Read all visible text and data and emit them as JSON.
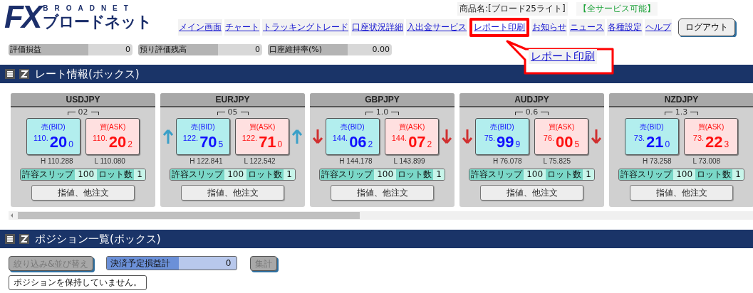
{
  "header": {
    "logo": {
      "mark": "FX",
      "latin": "BROADNET",
      "kana": "ブロードネット"
    },
    "product": "商品名:[ブロード25ライト]",
    "service_status": "【全サービス可能】",
    "nav": [
      {
        "label": "メイン画面",
        "highlighted": false
      },
      {
        "label": "チャート",
        "highlighted": false
      },
      {
        "label": "トラッキングトレード",
        "highlighted": false
      },
      {
        "label": "口座状況詳細",
        "highlighted": false
      },
      {
        "label": "入出金サービス",
        "highlighted": false
      },
      {
        "label": "レポート印刷",
        "highlighted": true
      },
      {
        "label": "お知らせ",
        "highlighted": false
      },
      {
        "label": "ニュース",
        "highlighted": false
      },
      {
        "label": "各種設定",
        "highlighted": false
      },
      {
        "label": "ヘルプ",
        "highlighted": false
      }
    ],
    "logout": "ログアウト"
  },
  "callout": {
    "label": "レポート印刷"
  },
  "summary": [
    {
      "label": "評価損益",
      "value": "0"
    },
    {
      "label": "預り評価残高",
      "value": "0"
    },
    {
      "label": "口座維持率(%)",
      "value": "0.00"
    }
  ],
  "rate_panel": {
    "title": "レート情報(ボックス)",
    "cards": [
      {
        "pair": "USDJPY",
        "spread": "02",
        "kind": "flat",
        "bid": {
          "label": "売(BID)",
          "big_figure": "110.",
          "pips": "20",
          "fraction": "0"
        },
        "ask": {
          "label": "買(ASK)",
          "big_figure": "110.",
          "pips": "20",
          "fraction": "2"
        },
        "high": "H 110.288",
        "low": "L 110.080",
        "slip_label": "許容スリップ",
        "slip": "100",
        "lot_label": "ロット数",
        "lot": "1",
        "order_button": "指値、他注文"
      },
      {
        "pair": "EURJPY",
        "spread": "05",
        "kind": "up",
        "bid": {
          "label": "売(BID)",
          "big_figure": "122.",
          "pips": "70",
          "fraction": "5"
        },
        "ask": {
          "label": "買(ASK)",
          "big_figure": "122.",
          "pips": "71",
          "fraction": "0"
        },
        "high": "H 122.841",
        "low": "L 122.542",
        "slip_label": "許容スリップ",
        "slip": "100",
        "lot_label": "ロット数",
        "lot": "1",
        "order_button": "指値、他注文"
      },
      {
        "pair": "GBPJPY",
        "spread": "1.0",
        "kind": "down",
        "bid": {
          "label": "売(BID)",
          "big_figure": "144.",
          "pips": "06",
          "fraction": "2"
        },
        "ask": {
          "label": "買(ASK)",
          "big_figure": "144.",
          "pips": "07",
          "fraction": "2"
        },
        "high": "H 144.178",
        "low": "L 143.899",
        "slip_label": "許容スリップ",
        "slip": "100",
        "lot_label": "ロット数",
        "lot": "1",
        "order_button": "指値、他注文"
      },
      {
        "pair": "AUDJPY",
        "spread": "0.6",
        "kind": "down",
        "bid": {
          "label": "売(BID)",
          "big_figure": "75.",
          "pips": "99",
          "fraction": "9"
        },
        "ask": {
          "label": "買(ASK)",
          "big_figure": "76.",
          "pips": "00",
          "fraction": "5"
        },
        "high": "H 76.078",
        "low": "L 75.825",
        "slip_label": "許容スリップ",
        "slip": "100",
        "lot_label": "ロット数",
        "lot": "1",
        "order_button": "指値、他注文"
      },
      {
        "pair": "NZDJPY",
        "spread": "1.3",
        "kind": "flat",
        "bid": {
          "label": "売(BID)",
          "big_figure": "73.",
          "pips": "21",
          "fraction": "0"
        },
        "ask": {
          "label": "買(ASK)",
          "big_figure": "73.",
          "pips": "22",
          "fraction": "3"
        },
        "high": "H 73.258",
        "low": "L 73.008",
        "slip_label": "許容スリップ",
        "slip": "100",
        "lot_label": "ロット数",
        "lot": "1",
        "order_button": "指値、他注文"
      }
    ]
  },
  "position_panel": {
    "title": "ポジション一覧(ボックス)",
    "filter_button": {
      "label": "絞り込み&並び替え",
      "disabled": true
    },
    "pl_field": {
      "label": "決済予定損益計",
      "value": "0"
    },
    "total_button": {
      "label": "集計",
      "disabled": true
    },
    "message": "ポジションを保持していません。"
  }
}
